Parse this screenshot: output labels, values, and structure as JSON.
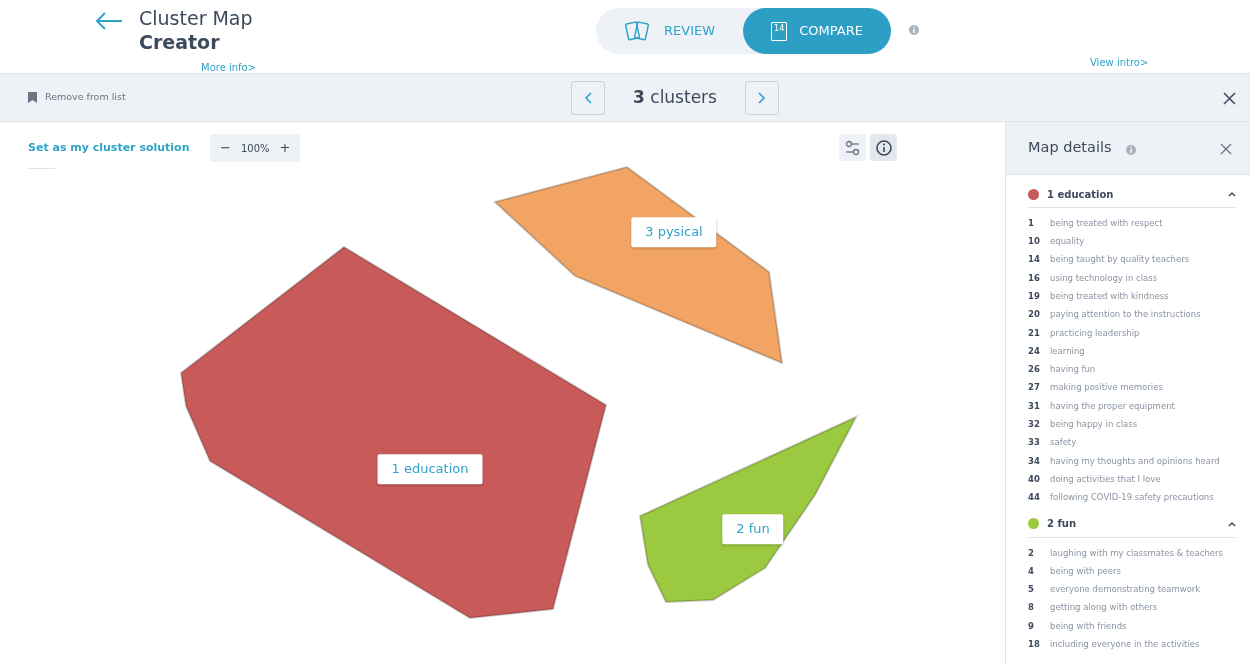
{
  "header": {
    "title_line1": "Cluster Map",
    "title_line2": "Creator",
    "more_info": "More info>",
    "view_intro": "View intro>"
  },
  "mode_tabs": [
    {
      "label": "REVIEW",
      "kind": "cards",
      "selected": false
    },
    {
      "label": "COMPARE",
      "kind": "count",
      "badge": "14",
      "selected": true
    }
  ],
  "toolbar": {
    "remove": "Remove from list",
    "title": "**3** clusters"
  },
  "map_controls": {
    "set_solution": "Set as my cluster solution",
    "zoom": "100%",
    "zoom_out": "−",
    "zoom_in": "+"
  },
  "map": {
    "clusters": [
      {
        "label": "1 education",
        "color": "#c85a5a"
      },
      {
        "label": "2 fun",
        "color": "#9bc93f"
      },
      {
        "label": "3 pysical",
        "color": "#f2a464"
      }
    ]
  },
  "details": {
    "title": "Map details",
    "groups": [
      {
        "label": "1 education",
        "color": "#c85a5a",
        "expanded": true,
        "items": [
          {
            "num": "1",
            "text": "being treated with respect"
          },
          {
            "num": "10",
            "text": "equality"
          },
          {
            "num": "14",
            "text": "being taught by quality teachers"
          },
          {
            "num": "16",
            "text": "using technology in class"
          },
          {
            "num": "19",
            "text": "being treated with kindness"
          },
          {
            "num": "20",
            "text": "paying attention to the instructions"
          },
          {
            "num": "21",
            "text": "practicing leadership"
          },
          {
            "num": "24",
            "text": "learning"
          },
          {
            "num": "26",
            "text": "having fun"
          },
          {
            "num": "27",
            "text": "making positive memories"
          },
          {
            "num": "31",
            "text": "having the proper equipment"
          },
          {
            "num": "32",
            "text": "being happy in class"
          },
          {
            "num": "33",
            "text": "safety"
          },
          {
            "num": "34",
            "text": "having my thoughts and opinions heard"
          },
          {
            "num": "40",
            "text": "doing activities that I love"
          },
          {
            "num": "44",
            "text": "following COVID-19 safety precautions"
          }
        ]
      },
      {
        "label": "2 fun",
        "color": "#9bc93f",
        "expanded": true,
        "items": [
          {
            "num": "2",
            "text": "laughing with my classmates & teachers"
          },
          {
            "num": "4",
            "text": "being with peers"
          },
          {
            "num": "5",
            "text": "everyone demonstrating teamwork"
          },
          {
            "num": "8",
            "text": "getting along with others"
          },
          {
            "num": "9",
            "text": "being with friends"
          },
          {
            "num": "18",
            "text": "including everyone in the activities"
          }
        ]
      }
    ]
  }
}
